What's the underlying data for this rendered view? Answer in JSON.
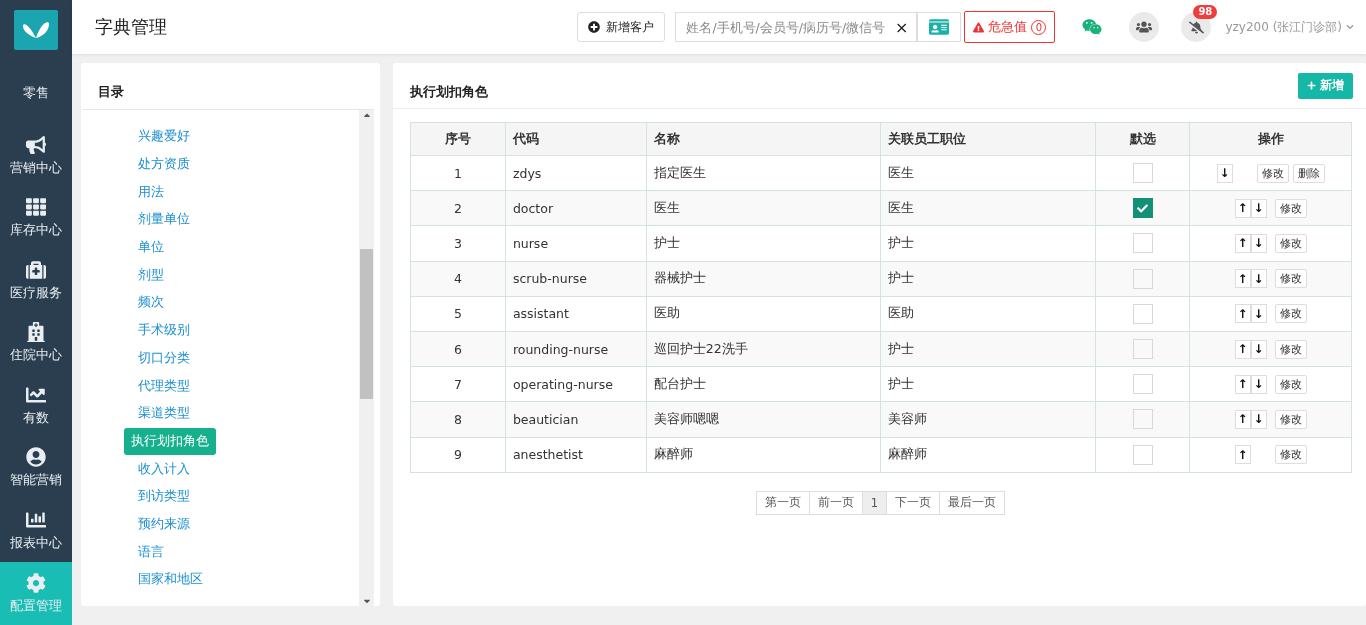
{
  "sidebar": {
    "items": [
      {
        "label": "零售",
        "selected": false
      },
      {
        "label": "营销中心",
        "selected": false
      },
      {
        "label": "库存中心",
        "selected": false
      },
      {
        "label": "医疗服务",
        "selected": false
      },
      {
        "label": "住院中心",
        "selected": false
      },
      {
        "label": "有数",
        "selected": false
      },
      {
        "label": "智能营销",
        "selected": false
      },
      {
        "label": "报表中心",
        "selected": false
      },
      {
        "label": "配置管理",
        "selected": true
      }
    ]
  },
  "header": {
    "title": "字典管理",
    "new_customer_button": "新增客户",
    "search": {
      "placeholder": "姓名/手机号/会员号/病历号/微信号",
      "clear": "×"
    },
    "alert_button": {
      "label": "危急值",
      "count": "0"
    },
    "notification_badge": "98",
    "user": "yzy200 (张江门诊部)"
  },
  "catalog": {
    "title": "目录",
    "items": [
      {
        "label": "兴趣爱好",
        "selected": false
      },
      {
        "label": "处方资质",
        "selected": false
      },
      {
        "label": "用法",
        "selected": false
      },
      {
        "label": "剂量单位",
        "selected": false
      },
      {
        "label": "单位",
        "selected": false
      },
      {
        "label": "剂型",
        "selected": false
      },
      {
        "label": "频次",
        "selected": false
      },
      {
        "label": "手术级别",
        "selected": false
      },
      {
        "label": "切口分类",
        "selected": false
      },
      {
        "label": "代理类型",
        "selected": false
      },
      {
        "label": "渠道类型",
        "selected": false
      },
      {
        "label": "执行划扣角色",
        "selected": true
      },
      {
        "label": "收入计入",
        "selected": false
      },
      {
        "label": "到访类型",
        "selected": false
      },
      {
        "label": "预约来源",
        "selected": false
      },
      {
        "label": "语言",
        "selected": false
      },
      {
        "label": "国家和地区",
        "selected": false
      }
    ]
  },
  "panel": {
    "title": "执行划扣角色",
    "add_button": "新增",
    "table": {
      "columns": [
        "序号",
        "代码",
        "名称",
        "关联员工职位",
        "默选",
        "操作"
      ],
      "rows": [
        {
          "index": "1",
          "code": "zdys",
          "name": "指定医生",
          "position": "医生",
          "checked": false,
          "buttons": [
            {
              "kind": "down",
              "label": "↓"
            },
            {
              "kind": "edit",
              "label": "修改"
            },
            {
              "kind": "delete",
              "label": "删除"
            }
          ]
        },
        {
          "index": "2",
          "code": "doctor",
          "name": "医生",
          "position": "医生",
          "checked": true,
          "buttons": [
            {
              "kind": "up",
              "label": "↑"
            },
            {
              "kind": "down",
              "label": "↓"
            },
            {
              "kind": "edit",
              "label": "修改"
            }
          ]
        },
        {
          "index": "3",
          "code": "nurse",
          "name": "护士",
          "position": "护士",
          "checked": false,
          "buttons": [
            {
              "kind": "up",
              "label": "↑"
            },
            {
              "kind": "down",
              "label": "↓"
            },
            {
              "kind": "edit",
              "label": "修改"
            }
          ]
        },
        {
          "index": "4",
          "code": "scrub-nurse",
          "name": "器械护士",
          "position": "护士",
          "checked": false,
          "buttons": [
            {
              "kind": "up",
              "label": "↑"
            },
            {
              "kind": "down",
              "label": "↓"
            },
            {
              "kind": "edit",
              "label": "修改"
            }
          ]
        },
        {
          "index": "5",
          "code": "assistant",
          "name": "医助",
          "position": "医助",
          "checked": false,
          "buttons": [
            {
              "kind": "up",
              "label": "↑"
            },
            {
              "kind": "down",
              "label": "↓"
            },
            {
              "kind": "edit",
              "label": "修改"
            }
          ]
        },
        {
          "index": "6",
          "code": "rounding-nurse",
          "name": "巡回护士22洗手",
          "position": "护士",
          "checked": false,
          "buttons": [
            {
              "kind": "up",
              "label": "↑"
            },
            {
              "kind": "down",
              "label": "↓"
            },
            {
              "kind": "edit",
              "label": "修改"
            }
          ]
        },
        {
          "index": "7",
          "code": "operating-nurse",
          "name": "配台护士",
          "position": "护士",
          "checked": false,
          "buttons": [
            {
              "kind": "up",
              "label": "↑"
            },
            {
              "kind": "down",
              "label": "↓"
            },
            {
              "kind": "edit",
              "label": "修改"
            }
          ]
        },
        {
          "index": "8",
          "code": "beautician",
          "name": "美容师嗯嗯",
          "position": "美容师",
          "checked": false,
          "buttons": [
            {
              "kind": "up",
              "label": "↑"
            },
            {
              "kind": "down",
              "label": "↓"
            },
            {
              "kind": "edit",
              "label": "修改"
            }
          ]
        },
        {
          "index": "9",
          "code": "anesthetist",
          "name": "麻醉师",
          "position": "麻醉师",
          "checked": false,
          "buttons": [
            {
              "kind": "up",
              "label": "↑"
            },
            {
              "kind": "edit",
              "label": "修改"
            }
          ]
        }
      ]
    },
    "pagination": [
      {
        "label": "第一页",
        "selected": false
      },
      {
        "label": "前一页",
        "selected": false
      },
      {
        "label": "1",
        "selected": true
      },
      {
        "label": "下一页",
        "selected": false
      },
      {
        "label": "最后一页",
        "selected": false
      }
    ]
  }
}
